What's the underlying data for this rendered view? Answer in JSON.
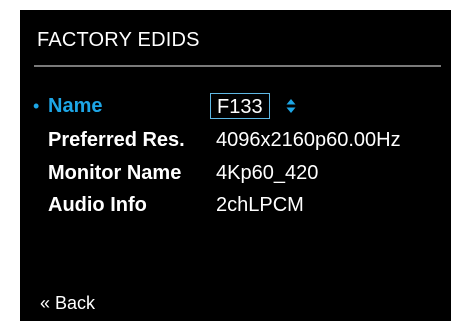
{
  "header": {
    "title": "FACTORY EDIDS"
  },
  "fields": [
    {
      "bullet": "•",
      "label": "Name",
      "value": "F133"
    },
    {
      "label": "Preferred Res.",
      "value": "4096x2160p60.00Hz"
    },
    {
      "label": "Monitor Name",
      "value": "4Kp60_420"
    },
    {
      "label": "Audio Info",
      "value": "2chLPCM"
    }
  ],
  "footer": {
    "back_label": "« Back"
  },
  "colors": {
    "background": "#000000",
    "text": "#ffffff",
    "accent": "#1da6e6",
    "divider": "#7a7a7a"
  },
  "icons": {
    "name_stepper": "up-down-arrow-icon"
  }
}
